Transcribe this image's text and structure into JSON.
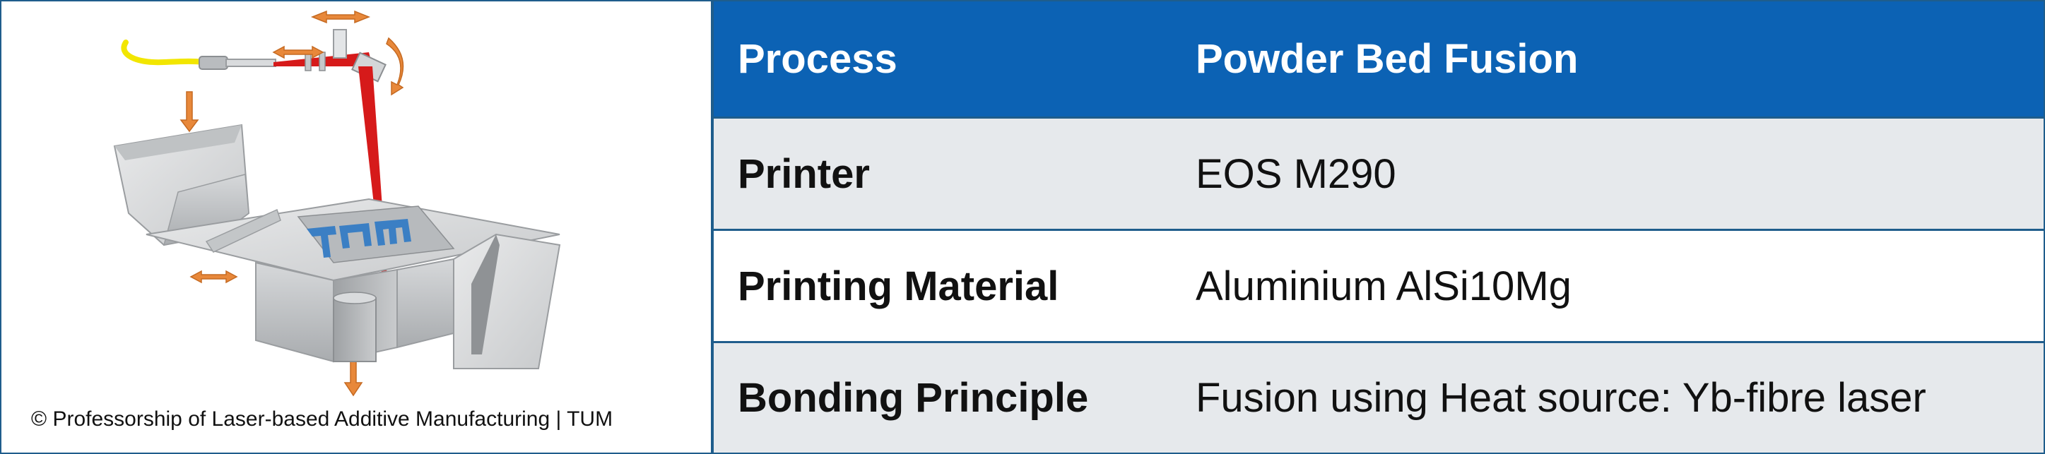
{
  "figure": {
    "credit": "© Professorship of Laser-based Additive Manufacturing | TUM",
    "logo_text": "TUM",
    "colors": {
      "laser": "#d61a1a",
      "fiber": "#f2e600",
      "arrows": "#e8883a",
      "metal": "#d4d6d8",
      "logo": "#3b7fc4"
    }
  },
  "table": {
    "header": {
      "key": "Process",
      "value": "Powder Bed Fusion"
    },
    "rows": [
      {
        "key": "Printer",
        "value": "EOS M290"
      },
      {
        "key": "Printing Material",
        "value": "Aluminium AlSi10Mg"
      },
      {
        "key": "Bonding Principle",
        "value": "Fusion using Heat source: Yb-fibre laser"
      }
    ],
    "colors": {
      "header_bg": "#0c62b4",
      "row_alt_bg": "#e6e9ec",
      "border": "#1f5d8c"
    }
  }
}
